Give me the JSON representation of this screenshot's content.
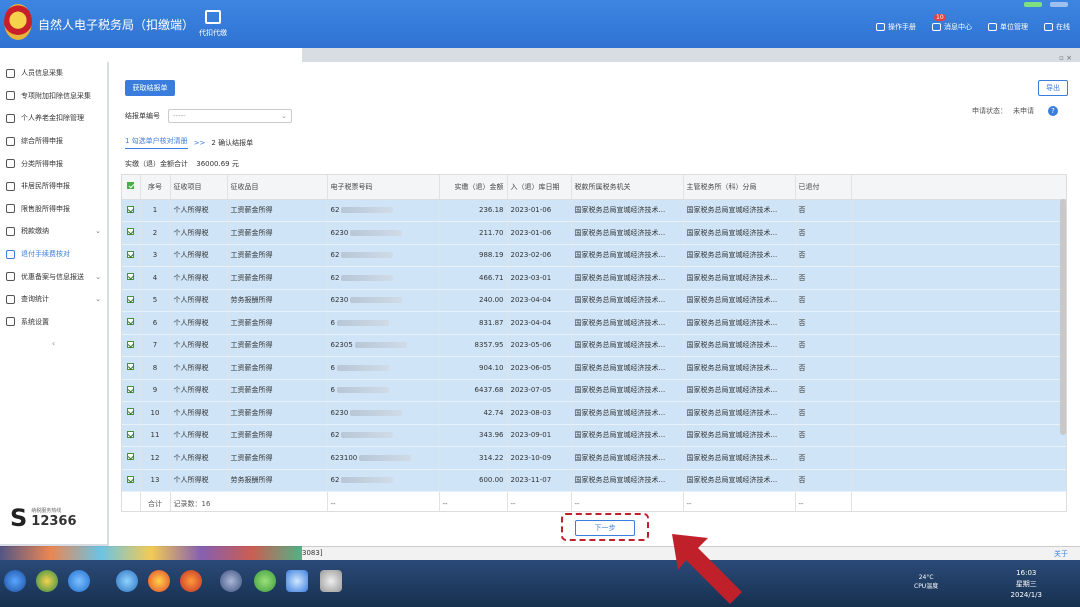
{
  "app": {
    "title": "自然人电子税务局（扣缴端）",
    "center_tab": "代扣代缴"
  },
  "topbar": {
    "items": [
      "操作手册",
      "消息中心",
      "单位管理",
      "在线"
    ],
    "msg_badge": "10"
  },
  "sidebar": {
    "items": [
      {
        "label": "人员信息采集",
        "icon": "person-icon",
        "chevron": false,
        "active": false
      },
      {
        "label": "专项附加扣除信息采集",
        "icon": "list-icon",
        "chevron": false,
        "active": false
      },
      {
        "label": "个人养老金扣除管理",
        "icon": "doc-icon",
        "chevron": false,
        "active": false
      },
      {
        "label": "综合所得申报",
        "icon": "form-icon",
        "chevron": false,
        "active": false
      },
      {
        "label": "分类所得申报",
        "icon": "clock-icon",
        "chevron": false,
        "active": false
      },
      {
        "label": "非居民所得申报",
        "icon": "user-icon",
        "chevron": false,
        "active": false
      },
      {
        "label": "限售股所得申报",
        "icon": "chart-icon",
        "chevron": false,
        "active": false
      },
      {
        "label": "税款缴纳",
        "icon": "wallet-icon",
        "chevron": true,
        "active": false
      },
      {
        "label": "退付手续费核对",
        "icon": "check-doc-icon",
        "chevron": false,
        "active": true
      },
      {
        "label": "优惠备案与信息报送",
        "icon": "gift-icon",
        "chevron": true,
        "active": false
      },
      {
        "label": "查询统计",
        "icon": "search-list-icon",
        "chevron": true,
        "active": false
      },
      {
        "label": "系统设置",
        "icon": "gear-icon",
        "chevron": false,
        "active": false
      }
    ],
    "collapse": "‹",
    "hotline_label": "纳税服务热线",
    "hotline": "12366"
  },
  "main": {
    "fetch_button": "获取结报单",
    "export_button": "导出",
    "status_label": "申请状态：",
    "status_value": "未申请",
    "field_label": "结报单编号",
    "field_value": "-----",
    "step1": "1 勾选单户核对清册",
    "step_sep": ">>",
    "step2": "2 确认结报单",
    "total_label": "实缴（退）金额合计",
    "total_value": "36000.69 元",
    "next_button": "下一步"
  },
  "table": {
    "columns": [
      "",
      "序号",
      "征收项目",
      "征收品目",
      "电子税票号码",
      "实缴（退）金额",
      "入（退）库日期",
      "税款所属税务机关",
      "主管税务所（科）分局",
      "已退付"
    ],
    "rows": [
      [
        "1",
        "个人所得税",
        "工资薪金所得",
        "62",
        "236.18",
        "2023-01-06",
        "国家税务总局宣城经济技术...",
        "国家税务总局宣城经济技术...",
        "否"
      ],
      [
        "2",
        "个人所得税",
        "工资薪金所得",
        "6230",
        "211.70",
        "2023-01-06",
        "国家税务总局宣城经济技术...",
        "国家税务总局宣城经济技术...",
        "否"
      ],
      [
        "3",
        "个人所得税",
        "工资薪金所得",
        "62",
        "988.19",
        "2023-02-06",
        "国家税务总局宣城经济技术...",
        "国家税务总局宣城经济技术...",
        "否"
      ],
      [
        "4",
        "个人所得税",
        "工资薪金所得",
        "62",
        "466.71",
        "2023-03-01",
        "国家税务总局宣城经济技术...",
        "国家税务总局宣城经济技术...",
        "否"
      ],
      [
        "5",
        "个人所得税",
        "劳务报酬所得",
        "6230",
        "240.00",
        "2023-04-04",
        "国家税务总局宣城经济技术...",
        "国家税务总局宣城经济技术...",
        "否"
      ],
      [
        "6",
        "个人所得税",
        "工资薪金所得",
        "6",
        "831.87",
        "2023-04-04",
        "国家税务总局宣城经济技术...",
        "国家税务总局宣城经济技术...",
        "否"
      ],
      [
        "7",
        "个人所得税",
        "工资薪金所得",
        "62305",
        "8357.95",
        "2023-05-06",
        "国家税务总局宣城经济技术...",
        "国家税务总局宣城经济技术...",
        "否"
      ],
      [
        "8",
        "个人所得税",
        "工资薪金所得",
        "6",
        "904.10",
        "2023-06-05",
        "国家税务总局宣城经济技术...",
        "国家税务总局宣城经济技术...",
        "否"
      ],
      [
        "9",
        "个人所得税",
        "工资薪金所得",
        "6",
        "6437.68",
        "2023-07-05",
        "国家税务总局宣城经济技术...",
        "国家税务总局宣城经济技术...",
        "否"
      ],
      [
        "10",
        "个人所得税",
        "工资薪金所得",
        "6230",
        "42.74",
        "2023-08-03",
        "国家税务总局宣城经济技术...",
        "国家税务总局宣城经济技术...",
        "否"
      ],
      [
        "11",
        "个人所得税",
        "工资薪金所得",
        "62",
        "343.96",
        "2023-09-01",
        "国家税务总局宣城经济技术...",
        "国家税务总局宣城经济技术...",
        "否"
      ],
      [
        "12",
        "个人所得税",
        "工资薪金所得",
        "623100",
        "314.22",
        "2023-10-09",
        "国家税务总局宣城经济技术...",
        "国家税务总局宣城经济技术...",
        "否"
      ],
      [
        "13",
        "个人所得税",
        "劳务报酬所得",
        "62",
        "600.00",
        "2023-11-07",
        "国家税务总局宣城经济技术...",
        "国家税务总局宣城经济技术...",
        "否"
      ]
    ],
    "footer": {
      "label": "合计",
      "count": "记录数：16",
      "dash": "--"
    }
  },
  "statusbar": {
    "left": "3083]",
    "right": "关于"
  },
  "taskbar": {
    "temp": "24°C",
    "temp_label": "CPU温度",
    "time": "16:03",
    "weekday": "星期三",
    "date": "2024/1/3"
  },
  "colors": {
    "accent": "#3b7ddd",
    "selected_row": "#cfe4f7",
    "highlight": "#c0202a"
  }
}
